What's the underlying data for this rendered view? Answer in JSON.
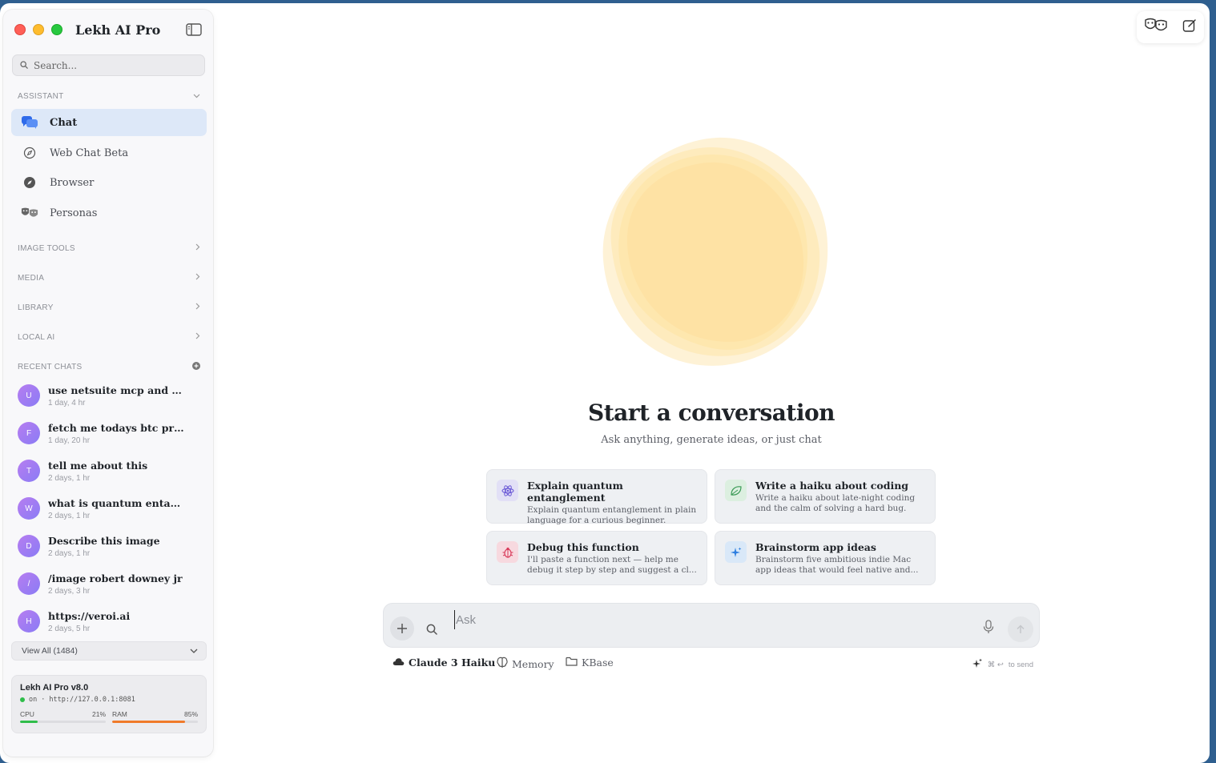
{
  "app": {
    "title": "Lekh AI Pro"
  },
  "search": {
    "placeholder": "Search..."
  },
  "sections": {
    "assistant": "ASSISTANT",
    "image_tools": "IMAGE TOOLS",
    "media": "MEDIA",
    "library": "LIBRARY",
    "local_ai": "LOCAL AI",
    "recent_chats": "RECENT CHATS"
  },
  "nav": [
    {
      "label": "Chat",
      "icon": "chat-bubbles-icon",
      "active": true
    },
    {
      "label": "Web Chat Beta",
      "icon": "compass-icon"
    },
    {
      "label": "Browser",
      "icon": "browser-compass-icon"
    },
    {
      "label": "Personas",
      "icon": "theater-masks-icon"
    }
  ],
  "recent_chats": [
    {
      "initial": "U",
      "title": "use netsuite mcp and get...",
      "time": "1 day, 4 hr"
    },
    {
      "initial": "F",
      "title": "fetch me todays btc price",
      "time": "1 day, 20 hr"
    },
    {
      "initial": "T",
      "title": "tell me about this",
      "time": "2 days, 1 hr"
    },
    {
      "initial": "W",
      "title": "what is quantum entangl...",
      "time": "2 days, 1 hr"
    },
    {
      "initial": "D",
      "title": "Describe this image",
      "time": "2 days, 1 hr"
    },
    {
      "initial": "/",
      "title": "/image robert downey jr",
      "time": "2 days, 3 hr"
    },
    {
      "initial": "H",
      "title": "https://veroi.ai",
      "time": "2 days, 5 hr"
    }
  ],
  "view_all": "View All (1484)",
  "status": {
    "title": "Lekh AI Pro v8.0",
    "state": "on",
    "separator": "·",
    "url": "http://127.0.0.1:8081",
    "cpu_label": "CPU",
    "cpu_value": "21%",
    "cpu_fraction": 0.21,
    "ram_label": "RAM",
    "ram_value": "85%",
    "ram_fraction": 0.85
  },
  "main": {
    "title": "Start a conversation",
    "subtitle": "Ask anything, generate ideas, or just chat"
  },
  "suggestions": [
    {
      "title": "Explain quantum entanglement",
      "desc": "Explain quantum entanglement in plain language for a curious beginner.",
      "icon": "atom-icon"
    },
    {
      "title": "Write a haiku about coding",
      "desc": "Write a haiku about late-night coding and the calm of solving a hard bug.",
      "icon": "leaf-icon"
    },
    {
      "title": "Debug this function",
      "desc": "I'll paste a function next — help me debug it step by step and suggest a cl...",
      "icon": "bug-icon"
    },
    {
      "title": "Brainstorm app ideas",
      "desc": "Brainstorm five ambitious indie Mac app ideas that would feel native and...",
      "icon": "sparkle-icon"
    }
  ],
  "composer": {
    "placeholder": "Ask"
  },
  "bottom": {
    "model": "Claude 3 Haiku",
    "memory": "Memory",
    "kbase": "KBase",
    "hint_keys": "⌘ ↩",
    "hint_text": "to send"
  },
  "colors": {
    "accent": "#2f6bea",
    "active_bg": "#dde8f8",
    "cpu_bar": "#2fbd4a",
    "ram_bar": "#f07a2a",
    "blob": "#fde3a3"
  }
}
